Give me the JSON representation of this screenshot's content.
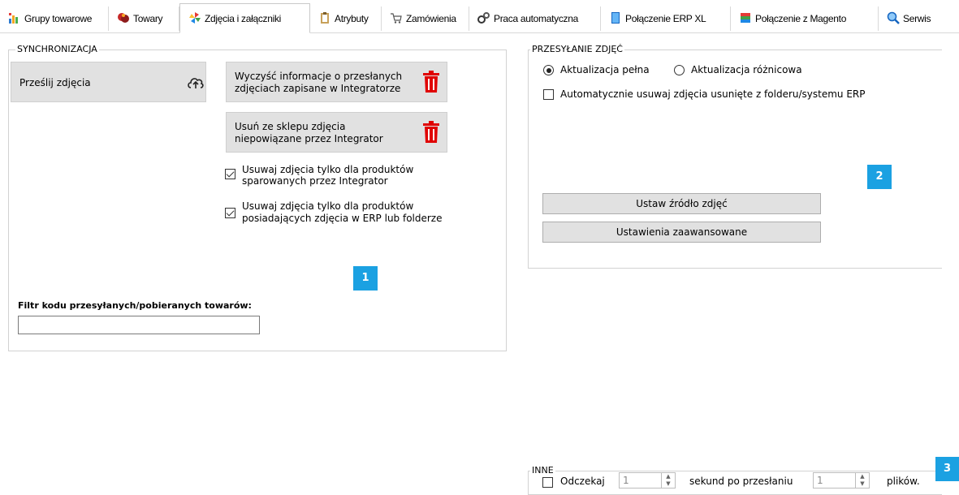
{
  "tabs": [
    {
      "label": "Grupy towarowe",
      "icon": "bar-chart-icon"
    },
    {
      "label": "Towary",
      "icon": "products-icon"
    },
    {
      "label": "Zdjęcia i załączniki",
      "icon": "pinwheel-icon"
    },
    {
      "label": "Atrybuty",
      "icon": "clipboard-icon"
    },
    {
      "label": "Zamówienia",
      "icon": "cart-icon"
    },
    {
      "label": "Praca automatyczna",
      "icon": "gears-icon"
    },
    {
      "label": "Połączenie ERP XL",
      "icon": "book-icon"
    },
    {
      "label": "Połączenie z Magento",
      "icon": "stack-icon"
    },
    {
      "label": "Serwis",
      "icon": "magnifier-icon"
    }
  ],
  "sync": {
    "title": "SYNCHRONIZACJA",
    "upload_label": "Prześlij zdjęcia",
    "clear_label_1": "Wyczyść informacje o przesłanych",
    "clear_label_2": "zdjęciach zapisane w Integratorze",
    "remove_label_1": "Usuń ze sklepu zdjęcia",
    "remove_label_2": "niepowiązane przez Integrator",
    "check1_line1": "Usuwaj zdjęcia tylko dla produktów",
    "check1_line2": "sparowanych przez Integrator",
    "check1_checked": true,
    "check2_line1": "Usuwaj zdjęcia tylko dla produktów",
    "check2_line2": "posiadających zdjęcia w ERP lub folderze",
    "check2_checked": true,
    "filter_label": "Filtr kodu przesyłanych/pobieranych towarów:",
    "filter_value": ""
  },
  "upload": {
    "title": "PRZESYŁANIE ZDJĘĆ",
    "radio_full": "Aktualizacja pełna",
    "radio_diff": "Aktualizacja różnicowa",
    "selected": "full",
    "auto_delete_label": "Automatycznie usuwaj zdjęcia usunięte z folderu/systemu ERP",
    "auto_delete_checked": false,
    "source_button": "Ustaw źródło zdjęć",
    "advanced_button": "Ustawienia zaawansowane"
  },
  "other": {
    "title": "INNE",
    "wait_label": "Odczekaj",
    "wait_value": "1",
    "seconds_label": "sekund po przesłaniu",
    "files_value": "1",
    "files_label": "plików."
  },
  "badges": {
    "one": "1",
    "two": "2",
    "three": "3"
  },
  "colors": {
    "badge": "#1ba1e2",
    "trash": "#e00000"
  }
}
